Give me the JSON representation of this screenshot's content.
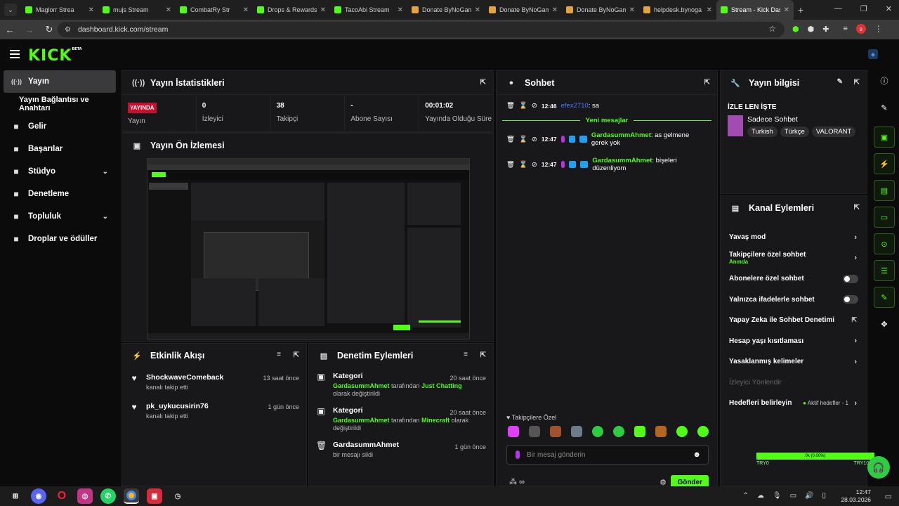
{
  "browser": {
    "tabs": [
      {
        "title": "Maglorr Strea",
        "icon": "kick-favicon",
        "color": "#53fc18"
      },
      {
        "title": "mujs Stream",
        "icon": "kick-favicon",
        "color": "#53fc18"
      },
      {
        "title": "CombatRy Str",
        "icon": "kick-favicon",
        "color": "#53fc18"
      },
      {
        "title": "Drops & Rewards",
        "icon": "kick-favicon",
        "color": "#53fc18"
      },
      {
        "title": "TacoAbi Stream",
        "icon": "kick-favicon",
        "color": "#53fc18"
      },
      {
        "title": "Donate ByNoGam",
        "icon": "donate-favicon",
        "color": "#e6a23c"
      },
      {
        "title": "Donate ByNoGam",
        "icon": "donate-favicon",
        "color": "#e6a23c"
      },
      {
        "title": "Donate ByNoGam",
        "icon": "donate-favicon",
        "color": "#e6a23c"
      },
      {
        "title": "helpdesk.bynoga",
        "icon": "helpdesk-favicon",
        "color": "#e6a23c"
      },
      {
        "title": "Stream - Kick Das",
        "icon": "kick-favicon",
        "color": "#53fc18",
        "active": true
      }
    ],
    "url": "dashboard.kick.com/stream",
    "new_tab": "+"
  },
  "app": {
    "logo": "KICK",
    "logo_beta": "BETA",
    "accent": "#53fc18"
  },
  "sidebar": {
    "items": [
      {
        "label": "Yayın",
        "icon": "broadcast-icon",
        "active": true
      },
      {
        "label": "Yayın Bağlantısı ve Anahtarı",
        "sub": true
      },
      {
        "label": "Gelir",
        "icon": "revenue-icon"
      },
      {
        "label": "Başarılar",
        "icon": "trophy-icon"
      },
      {
        "label": "Stüdyo",
        "icon": "studio-icon",
        "chev": "⌄"
      },
      {
        "label": "Denetleme",
        "icon": "wrench-icon"
      },
      {
        "label": "Topluluk",
        "icon": "community-icon",
        "chev": "⌄"
      },
      {
        "label": "Droplar ve ödüller",
        "icon": "drops-icon"
      }
    ]
  },
  "stats": {
    "title": "Yayın İstatistikleri",
    "live_badge": "YAYINDA",
    "live_label": "Yayın",
    "viewers_value": "0",
    "viewers_label": "İzleyici",
    "followers_value": "38",
    "followers_label": "Takipçi",
    "subs_value": "-",
    "subs_label": "Abone Sayısı",
    "uptime_value": "00:01:02",
    "uptime_label": "Yayında Olduğu Süre"
  },
  "preview": {
    "title": "Yayın Ön İzlemesi"
  },
  "activity": {
    "title": "Etkinlik Akışı",
    "items": [
      {
        "name": "ShockwaveComeback",
        "sub": "kanalı takip etti",
        "time": "13 saat önce"
      },
      {
        "name": "pk_uykucusirin76",
        "sub": "kanalı takip etti",
        "time": "1 gün önce"
      }
    ]
  },
  "moderation": {
    "title": "Denetim Eylemleri",
    "items": [
      {
        "title": "Kategori",
        "user": "GardasummAhmet",
        "mid": " tarafından ",
        "cat": "Just Chatting",
        "end": " olarak değiştirildi",
        "time": "20 saat önce"
      },
      {
        "title": "Kategori",
        "user": "GardasummAhmet",
        "mid": " tarafından ",
        "cat": "Minecraft",
        "end": " olarak değiştirildi",
        "time": "20 saat önce"
      },
      {
        "title": "GardasummAhmet",
        "plain": "bir mesajı sildi",
        "time": "1 gün önce"
      }
    ]
  },
  "chat": {
    "title": "Sohbet",
    "msg0": {
      "time": "12:46",
      "user": "efex2710",
      "text": ": sa"
    },
    "new_messages": "Yeni mesajlar",
    "msg1": {
      "time": "12:47",
      "user": "GardasummAhmet",
      "text": ": as gelmene gerek yok"
    },
    "msg2": {
      "time": "12:47",
      "user": "GardasummAhmet",
      "text": ": bişeleri düzenliyom"
    },
    "followers_only": "Takipçilere Özel",
    "placeholder": "Bir mesaj gönderin",
    "send": "Gönder",
    "infinity": "∞"
  },
  "streaminfo": {
    "title": "Yayın bilgisi",
    "heading": "İZLE LEN İŞTE",
    "category": "Sadece Sohbet",
    "tags": [
      "Turkish",
      "Türkçe",
      "VALORANT"
    ]
  },
  "channel_actions": {
    "title": "Kanal Eylemleri",
    "slow": "Yavaş mod",
    "followers": "Takipçilere özel sohbet",
    "followers_sub": "Anında",
    "subs": "Abonelere özel sohbet",
    "emotes": "Yalnızca ifadelerle sohbet",
    "ai": "Yapay Zeka ile Sohbet Denetimi",
    "age": "Hesap yaşı kısıtlaması",
    "banned": "Yasaklanmış kelimeler",
    "redirect": "İzleyici Yönlendir",
    "goals": "Hedefleri belirleyin",
    "goals_active": "Aktif hedefler - 1"
  },
  "overlay": {
    "progress_text": "0k (0.00%)",
    "left": "TRY0",
    "right": "TRY1000",
    "progress": 0
  },
  "taskbar": {
    "time": "12:47",
    "date": "28.03.2026"
  }
}
